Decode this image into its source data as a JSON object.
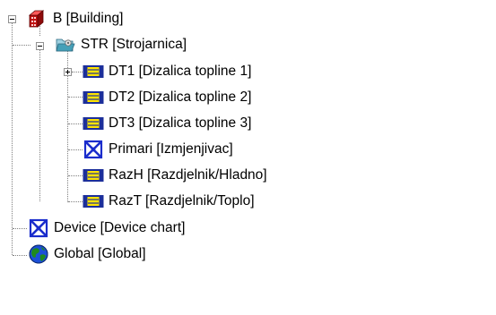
{
  "tree": {
    "root": {
      "label": "B  [Building]",
      "icon": "building-icon",
      "expanded": true,
      "children": [
        {
          "label": "STR  [Strojarnica]",
          "icon": "open-folder-icon",
          "expanded": true,
          "children": [
            {
              "label": "DT1  [Dizalica topline 1]",
              "icon": "device-block-icon",
              "expanded": false,
              "has_children": true
            },
            {
              "label": "DT2  [Dizalica topline 2]",
              "icon": "device-block-icon"
            },
            {
              "label": "DT3  [Dizalica topline 3]",
              "icon": "device-block-icon"
            },
            {
              "label": "Primari  [Izmjenjivac]",
              "icon": "heat-exchanger-icon"
            },
            {
              "label": "RazH  [Razdjelnik/Hladno]",
              "icon": "device-block-icon"
            },
            {
              "label": "RazT  [Razdjelnik/Toplo]",
              "icon": "device-block-icon"
            }
          ]
        },
        {
          "label": "Device  [Device chart]",
          "icon": "heat-exchanger-icon"
        },
        {
          "label": "Global  [Global]",
          "icon": "globe-icon"
        }
      ]
    },
    "colors": {
      "device_block_border": "#1c2f9a",
      "device_block_fill": "#ffe400",
      "exchanger_blue": "#1a2ccc",
      "building_red": "#d81616",
      "globe_green": "#1f8a1f",
      "globe_blue": "#1c4fd8",
      "folder_teal": "#46a0b8"
    }
  }
}
